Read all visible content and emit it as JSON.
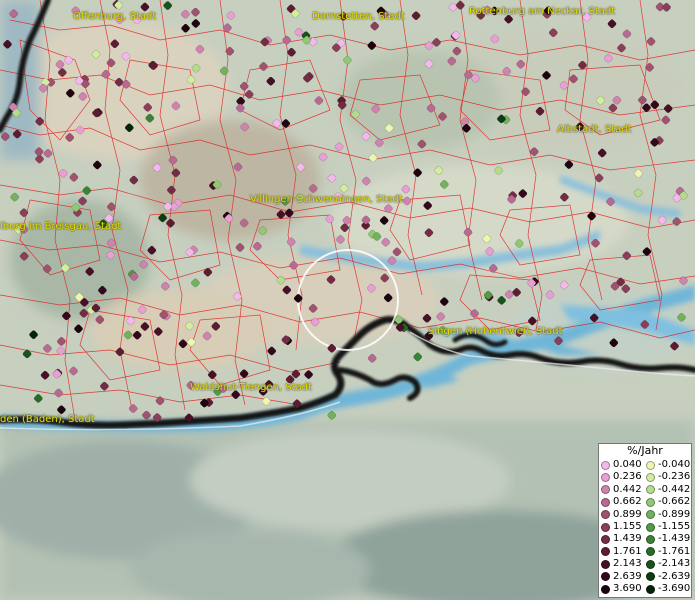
{
  "map": {
    "cities": [
      {
        "id": "offenburg",
        "label": "Offenburg, Stadt"
      },
      {
        "id": "dornstetten",
        "label": "Dornstetten, Stadt"
      },
      {
        "id": "rottenburg",
        "label": "Rottenburg am Neckar, Stadt"
      },
      {
        "id": "albstadt",
        "label": "Albstadt, Stadt"
      },
      {
        "id": "villingen",
        "label": "Villingen-Schwenningen, Stadt"
      },
      {
        "id": "freiburg",
        "label": "iburg im Breisgau, Stadt"
      },
      {
        "id": "singen",
        "label": "Singen (Hohentwiel), Stadt"
      },
      {
        "id": "waldshut",
        "label": "Waldshut-Tiengen, Stadt"
      },
      {
        "id": "baden",
        "label": "den (Baden), Stadt"
      }
    ],
    "colors": {
      "district_lines": "#e02020",
      "border_dark": "#141414",
      "water": "#6fb6d8"
    }
  },
  "legend": {
    "title": "%/Jahr",
    "positive": [
      {
        "value": "0.040",
        "color": "#f4b8ec"
      },
      {
        "value": "0.236",
        "color": "#e8a0d4"
      },
      {
        "value": "0.442",
        "color": "#cf84b0"
      },
      {
        "value": "0.662",
        "color": "#b86a92"
      },
      {
        "value": "0.899",
        "color": "#a0526f"
      },
      {
        "value": "1.155",
        "color": "#8a3e58"
      },
      {
        "value": "1.439",
        "color": "#742c44"
      },
      {
        "value": "1.761",
        "color": "#5e1c33"
      },
      {
        "value": "2.143",
        "color": "#481026"
      },
      {
        "value": "2.639",
        "color": "#32081a"
      },
      {
        "value": "3.690",
        "color": "#1e030e"
      }
    ],
    "negative": [
      {
        "value": "-0.040",
        "color": "#eef5b0"
      },
      {
        "value": "-0.236",
        "color": "#d2eca0"
      },
      {
        "value": "-0.442",
        "color": "#b4dc8c"
      },
      {
        "value": "-0.662",
        "color": "#92c874"
      },
      {
        "value": "-0.899",
        "color": "#72b25c"
      },
      {
        "value": "-1.155",
        "color": "#529a46"
      },
      {
        "value": "-1.439",
        "color": "#3a8236"
      },
      {
        "value": "-1.761",
        "color": "#286a28"
      },
      {
        "value": "-2.143",
        "color": "#18521c"
      },
      {
        "value": "-2.639",
        "color": "#0c3c12"
      },
      {
        "value": "-3.690",
        "color": "#04240a"
      }
    ]
  }
}
